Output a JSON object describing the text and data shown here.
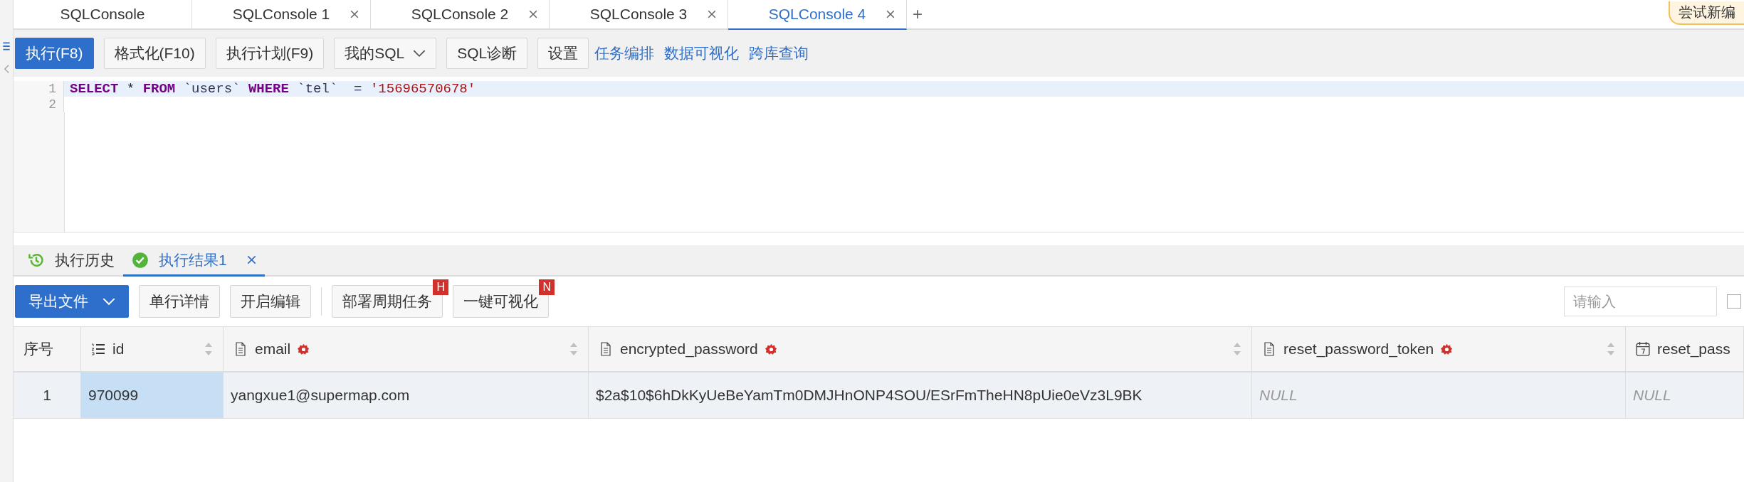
{
  "tabs": [
    {
      "label": "SQLConsole",
      "selected": false,
      "closable": false
    },
    {
      "label": "SQLConsole 1",
      "selected": false,
      "closable": true
    },
    {
      "label": "SQLConsole 2",
      "selected": false,
      "closable": true
    },
    {
      "label": "SQLConsole 3",
      "selected": false,
      "closable": true
    },
    {
      "label": "SQLConsole 4",
      "selected": true,
      "closable": true
    }
  ],
  "new_tab": "+",
  "try_badge": "尝试新编",
  "toolbar": [
    {
      "label": "执行(F8)",
      "kind": "primary"
    },
    {
      "label": "格式化(F10)",
      "kind": "default"
    },
    {
      "label": "执行计划(F9)",
      "kind": "default"
    },
    {
      "label": "我的SQL",
      "kind": "dropdown"
    },
    {
      "label": "SQL诊断",
      "kind": "default"
    },
    {
      "label": "设置",
      "kind": "default"
    },
    {
      "label": "任务编排",
      "kind": "link"
    },
    {
      "label": "数据可视化",
      "kind": "link"
    },
    {
      "label": "跨库查询",
      "kind": "link"
    }
  ],
  "editor": {
    "lines": [
      {
        "number": "1",
        "current": true,
        "tokens": [
          {
            "text": "SELECT",
            "kind": "keyword"
          },
          {
            "text": " * ",
            "kind": "plain"
          },
          {
            "text": "FROM",
            "kind": "keyword"
          },
          {
            "text": " `users` ",
            "kind": "ident"
          },
          {
            "text": "WHERE",
            "kind": "keyword"
          },
          {
            "text": " `tel`  = ",
            "kind": "ident"
          },
          {
            "text": "'15696570678'",
            "kind": "string"
          }
        ]
      },
      {
        "number": "2",
        "current": false
      }
    ]
  },
  "result_tabs": [
    {
      "label": "执行历史",
      "kind": "history",
      "selected": false,
      "closable": false
    },
    {
      "label": "执行结果1",
      "kind": "result",
      "selected": true,
      "closable": true
    }
  ],
  "result_toolbar": [
    {
      "label": "导出文件",
      "kind": "dropdown"
    },
    {
      "label": "单行详情",
      "kind": "default"
    },
    {
      "label": "开启编辑",
      "kind": "default"
    },
    {
      "label": "部署周期任务",
      "kind": "default",
      "badge": "H"
    },
    {
      "label": "一键可视化",
      "kind": "default",
      "badge": "N"
    }
  ],
  "search": {
    "placeholder": "请输入"
  },
  "filter_checkbox": {
    "checked": false
  },
  "table": {
    "columns": [
      {
        "label": "序号",
        "kind": "index",
        "flag": false,
        "sortable": false
      },
      {
        "label": "id",
        "kind": "list",
        "flag": false,
        "sortable": true
      },
      {
        "label": "email",
        "kind": "doc",
        "flag": true,
        "sortable": true
      },
      {
        "label": "encrypted_password",
        "kind": "doc",
        "flag": true,
        "sortable": true
      },
      {
        "label": "reset_password_token",
        "kind": "doc",
        "flag": true,
        "sortable": true
      },
      {
        "label": "reset_pass",
        "kind": "calendar",
        "flag": false
      }
    ],
    "rows": [
      {
        "cells": [
          {
            "text": "1",
            "kind": "index",
            "selected": false
          },
          {
            "text": "970099",
            "kind": "value",
            "selected": true
          },
          {
            "text": "yangxue1@supermap.com",
            "kind": "value",
            "selected": false
          },
          {
            "text": "$2a$10$6hDkKyUeBeYamTm0DMJHnONP4SOU/ESrFmTheHN8pUie0eVz3L9BK",
            "kind": "value",
            "selected": false
          },
          {
            "text": "NULL",
            "kind": "null",
            "selected": false
          },
          {
            "text": "NULL",
            "kind": "null",
            "selected": false
          }
        ]
      }
    ]
  }
}
